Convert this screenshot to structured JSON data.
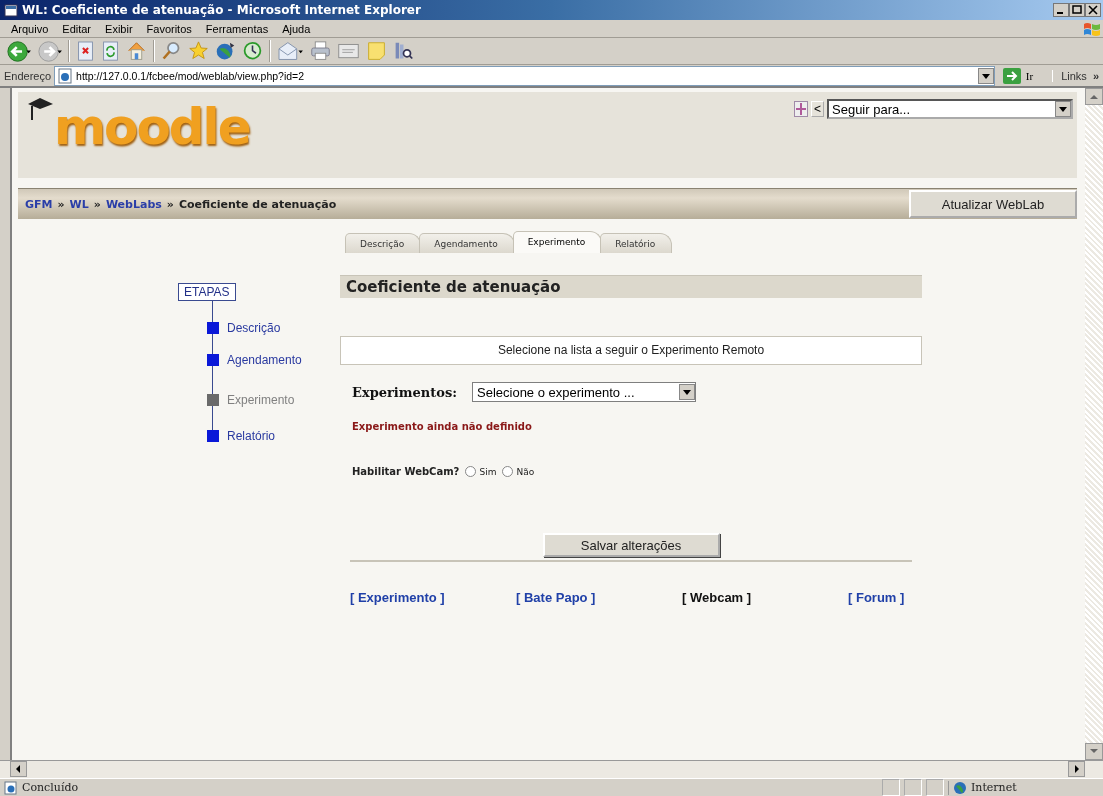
{
  "window": {
    "title": "WL: Coeficiente de atenuação - Microsoft Internet Explorer"
  },
  "menu_bar": [
    "Arquivo",
    "Editar",
    "Exibir",
    "Favoritos",
    "Ferramentas",
    "Ajuda"
  ],
  "address_bar": {
    "label": "Endereço",
    "url": "http://127.0.0.1/fcbee/mod/weblab/view.php?id=2",
    "go_label": "Ir",
    "links_label": "Links",
    "more": "»"
  },
  "header": {
    "logo": "moodle",
    "back_label": "<",
    "jump_value": "Seguir para..."
  },
  "breadcrumb": [
    {
      "label": "GFM",
      "kind": "link"
    },
    {
      "label": "»",
      "kind": "sep"
    },
    {
      "label": "WL",
      "kind": "link"
    },
    {
      "label": "»",
      "kind": "sep"
    },
    {
      "label": "WebLabs",
      "kind": "link"
    },
    {
      "label": "»",
      "kind": "sep"
    },
    {
      "label": "Coeficiente de atenuação",
      "kind": "current"
    }
  ],
  "update_button": "Atualizar WebLab",
  "tabs": [
    {
      "label": "Descrição",
      "selected": false
    },
    {
      "label": "Agendamento",
      "selected": false
    },
    {
      "label": "Experimento",
      "selected": true
    },
    {
      "label": "Relatório",
      "selected": false
    }
  ],
  "steps": {
    "title": "ETAPAS",
    "items": [
      {
        "label": "Descrição",
        "current": false
      },
      {
        "label": "Agendamento",
        "current": false
      },
      {
        "label": "Experimento",
        "current": true
      },
      {
        "label": "Relatório",
        "current": false
      }
    ]
  },
  "main": {
    "heading": "Coeficiente de atenuação",
    "instruction": "Selecione na lista a seguir o Experimento Remoto",
    "experiments_label": "Experimentos:",
    "experiments_value": "Selecione o experimento ...",
    "error": "Experimento ainda não definido",
    "webcam_label": "Habilitar WebCam?",
    "webcam_options": [
      {
        "label": "Sim",
        "selected": false
      },
      {
        "label": "Não",
        "selected": false
      }
    ],
    "save_button": "Salvar alterações"
  },
  "links": [
    {
      "label": "[ Experimento ]",
      "selected": false
    },
    {
      "label": "[ Bate Papo ]",
      "selected": false
    },
    {
      "label": "[ Webcam ]",
      "selected": true
    },
    {
      "label": "[ Forum ]",
      "selected": false
    }
  ],
  "status_bar": {
    "text": "Concluído",
    "zone": "Internet"
  }
}
